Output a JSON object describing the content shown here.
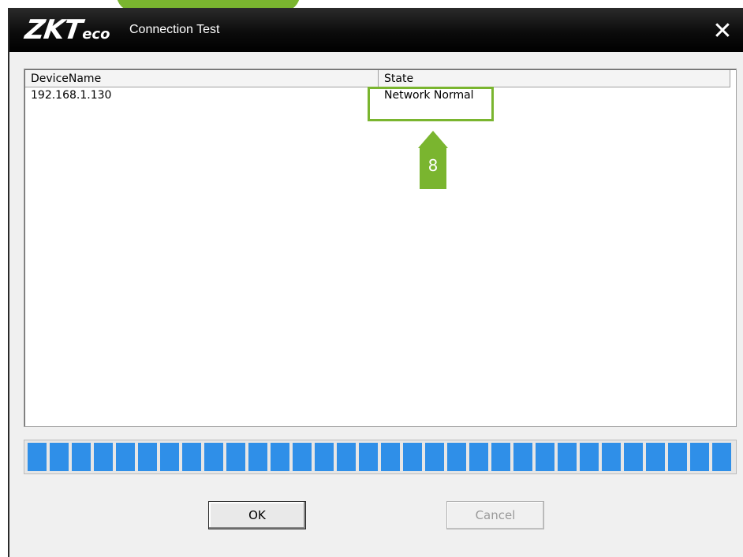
{
  "window": {
    "logo_main": "ZKT",
    "logo_sub": "eco",
    "title": "Connection Test",
    "close_glyph": "✕"
  },
  "table": {
    "headers": [
      "DeviceName",
      "State"
    ],
    "rows": [
      [
        "192.168.1.130",
        "Network Normal"
      ]
    ]
  },
  "annotation": {
    "marker_label": "8",
    "color": "#7ab52f"
  },
  "progress": {
    "percent": 100,
    "color": "#2f8fe8"
  },
  "buttons": {
    "ok_label": "OK",
    "cancel_label": "Cancel"
  }
}
